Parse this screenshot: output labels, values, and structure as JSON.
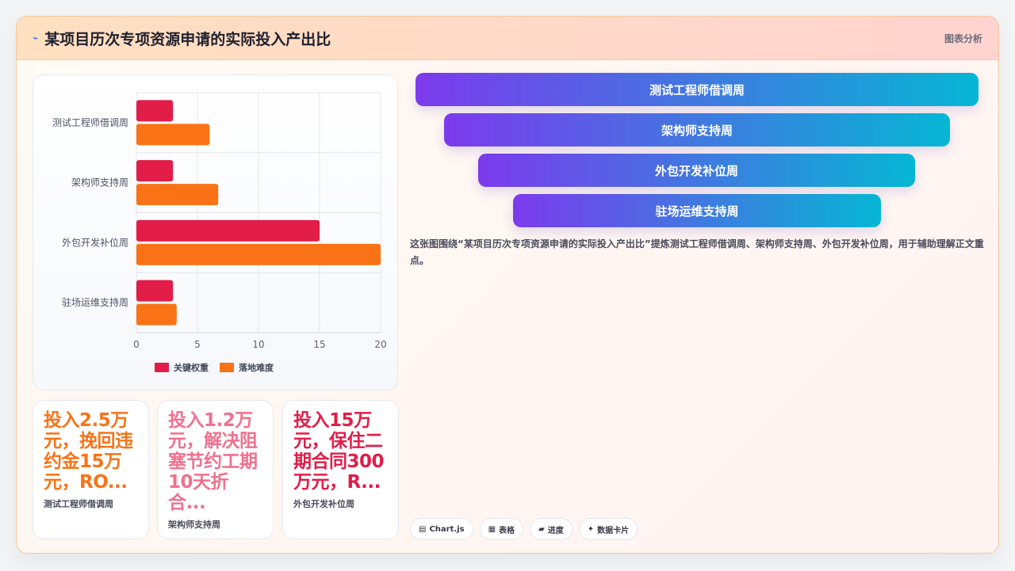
{
  "header": {
    "title": "某项目历次专项资源申请的实际投入产出比",
    "right_label": "图表分析"
  },
  "chart_data": {
    "type": "bar",
    "orientation": "horizontal",
    "categories": [
      "测试工程师借调周",
      "架构师支持周",
      "外包开发补位周",
      "驻场运维支持周"
    ],
    "series": [
      {
        "name": "关键权重",
        "color": "#e11d48",
        "values": [
          3,
          3,
          15,
          3
        ]
      },
      {
        "name": "落地难度",
        "color": "#f97316",
        "values": [
          6,
          6.7,
          20,
          3.3
        ]
      }
    ],
    "xlim": [
      0,
      20
    ],
    "xticks": [
      0,
      5,
      10,
      15,
      20
    ],
    "grid": true,
    "legend": "bottom"
  },
  "kpis": [
    {
      "value": "投入2.5万元，挽回违约金15万元，RO...",
      "label": "测试工程师借调周",
      "color": "#f97316"
    },
    {
      "value": "投入1.2万元，解决阻塞节约工期10天折合...",
      "label": "架构师支持周",
      "color": "#f0708e"
    },
    {
      "value": "投入15万元，保住二期合同300万元，R...",
      "label": "外包开发补位周",
      "color": "#e11d48"
    }
  ],
  "funnel": [
    {
      "label": "测试工程师借调周"
    },
    {
      "label": "架构师支持周"
    },
    {
      "label": "外包开发补位周"
    },
    {
      "label": "驻场运维支持周"
    }
  ],
  "description": "这张图围绕“某项目历次专项资源申请的实际投入产出比”提炼测试工程师借调周、架构师支持周、外包开发补位周，用于辅助理解正文重点。",
  "pills": [
    {
      "icon": "chart-icon",
      "glyph": "▤",
      "label": "Chart.js"
    },
    {
      "icon": "table-icon",
      "glyph": "▦",
      "label": "表格"
    },
    {
      "icon": "progress-icon",
      "glyph": "▰",
      "label": "进度"
    },
    {
      "icon": "sparkle-icon",
      "glyph": "✦",
      "label": "数据卡片"
    }
  ]
}
